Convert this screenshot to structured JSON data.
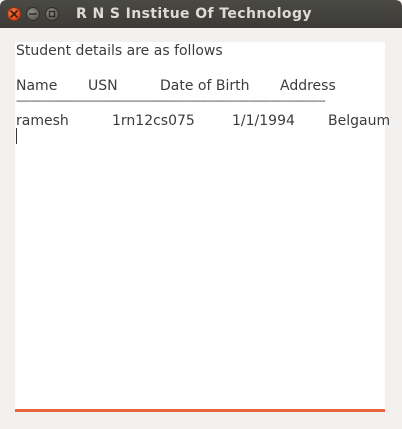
{
  "window": {
    "title": "R N S Institue Of Technology",
    "accent_color": "#dd4814"
  },
  "titlebar": {
    "close_icon": "close-icon",
    "minimize_icon": "minimize-icon",
    "maximize_icon": "maximize-icon"
  },
  "content": {
    "intro": "Student details are as follows",
    "headers": [
      "Name",
      "USN",
      "Date of Birth",
      "Address"
    ],
    "divider": "--------------------------------------------------------------------------------------------------------",
    "rows": [
      [
        "ramesh",
        "1rn12cs075",
        "1/1/1994",
        "Belgaum"
      ]
    ]
  }
}
